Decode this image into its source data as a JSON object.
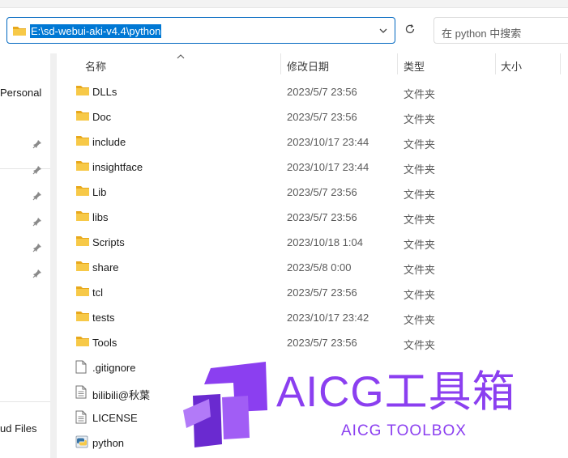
{
  "address_bar": {
    "path": "E:\\sd-webui-aki-v4.4\\python"
  },
  "search": {
    "placeholder": "在 python 中搜索"
  },
  "nav": {
    "personal_label": "Personal",
    "cloud_label": "ud Files"
  },
  "columns": {
    "name": "名称",
    "modified": "修改日期",
    "type": "类型",
    "size": "大小"
  },
  "files": [
    {
      "name": "DLLs",
      "date": "2023/5/7 23:56",
      "type": "文件夹",
      "icon": "folder-icon"
    },
    {
      "name": "Doc",
      "date": "2023/5/7 23:56",
      "type": "文件夹",
      "icon": "folder-icon"
    },
    {
      "name": "include",
      "date": "2023/10/17 23:44",
      "type": "文件夹",
      "icon": "folder-icon"
    },
    {
      "name": "insightface",
      "date": "2023/10/17 23:44",
      "type": "文件夹",
      "icon": "folder-icon"
    },
    {
      "name": "Lib",
      "date": "2023/5/7 23:56",
      "type": "文件夹",
      "icon": "folder-icon"
    },
    {
      "name": "libs",
      "date": "2023/5/7 23:56",
      "type": "文件夹",
      "icon": "folder-icon"
    },
    {
      "name": "Scripts",
      "date": "2023/10/18 1:04",
      "type": "文件夹",
      "icon": "folder-icon"
    },
    {
      "name": "share",
      "date": "2023/5/8 0:00",
      "type": "文件夹",
      "icon": "folder-icon"
    },
    {
      "name": "tcl",
      "date": "2023/5/7 23:56",
      "type": "文件夹",
      "icon": "folder-icon"
    },
    {
      "name": "tests",
      "date": "2023/10/17 23:42",
      "type": "文件夹",
      "icon": "folder-icon"
    },
    {
      "name": "Tools",
      "date": "2023/5/7 23:56",
      "type": "文件夹",
      "icon": "folder-icon"
    },
    {
      "name": ".gitignore",
      "date": "",
      "type": "",
      "icon": "file-icon"
    },
    {
      "name": "bilibili@秋葉",
      "date": "",
      "type": "",
      "icon": "text-file-icon"
    },
    {
      "name": "LICENSE",
      "date": "",
      "type": "",
      "icon": "text-file-icon"
    },
    {
      "name": "python",
      "date": "",
      "type": "",
      "icon": "python-icon"
    }
  ],
  "watermark": {
    "title": "AICG工具箱",
    "subtitle": "AICG TOOLBOX"
  },
  "colors": {
    "accent": "#0078d4",
    "folder": "#f7c948",
    "watermark": "#8b3ff0"
  }
}
